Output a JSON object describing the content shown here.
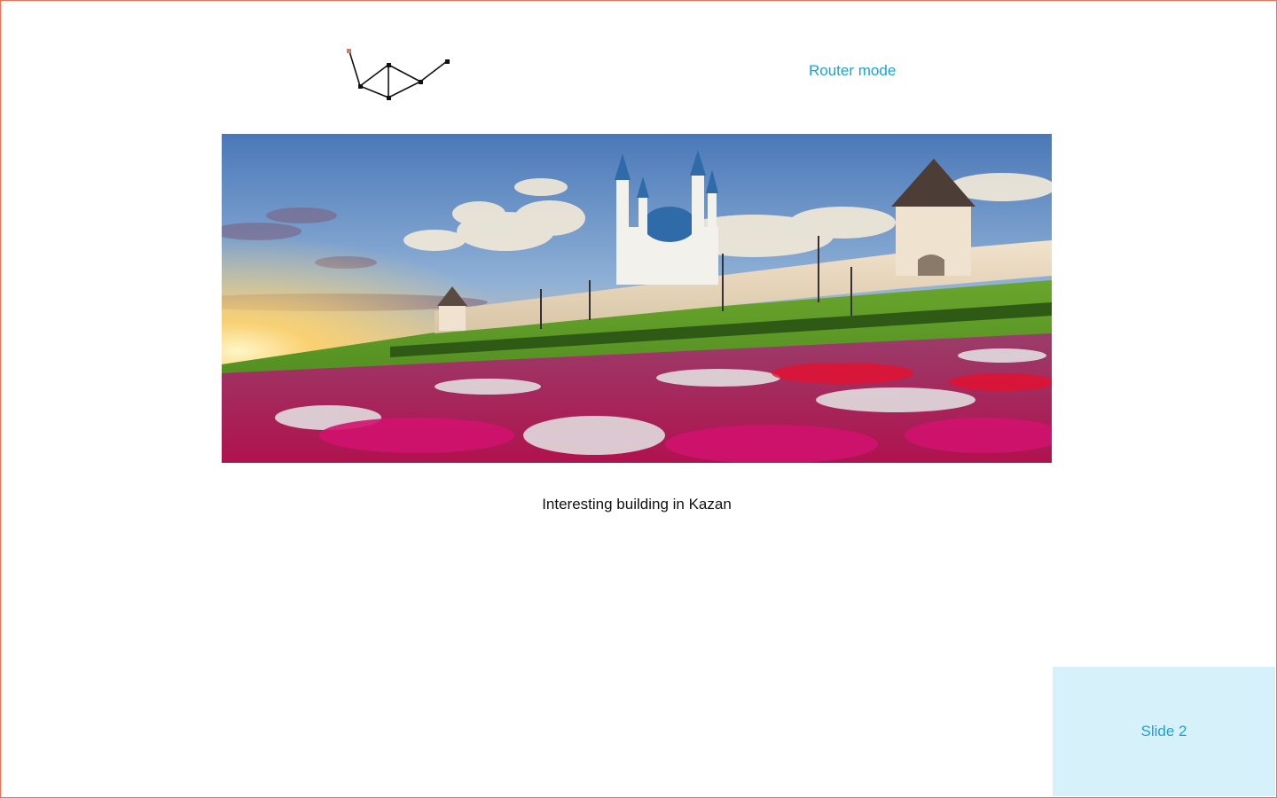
{
  "header": {
    "router_mode_label": "Router mode"
  },
  "graph": {
    "icon": "network-graph-icon",
    "highlight_color": "#e8735a"
  },
  "media": {
    "image_subject": "Kazan Kremlin with Kul Sharif mosque and flower field at sunset",
    "caption": "Interesting building in Kazan"
  },
  "slide": {
    "label": "Slide 2"
  },
  "colors": {
    "frame_border": "#e8735a",
    "accent": "#1aa3d6",
    "badge_bg": "#d7f1fb",
    "text": "#111111"
  }
}
